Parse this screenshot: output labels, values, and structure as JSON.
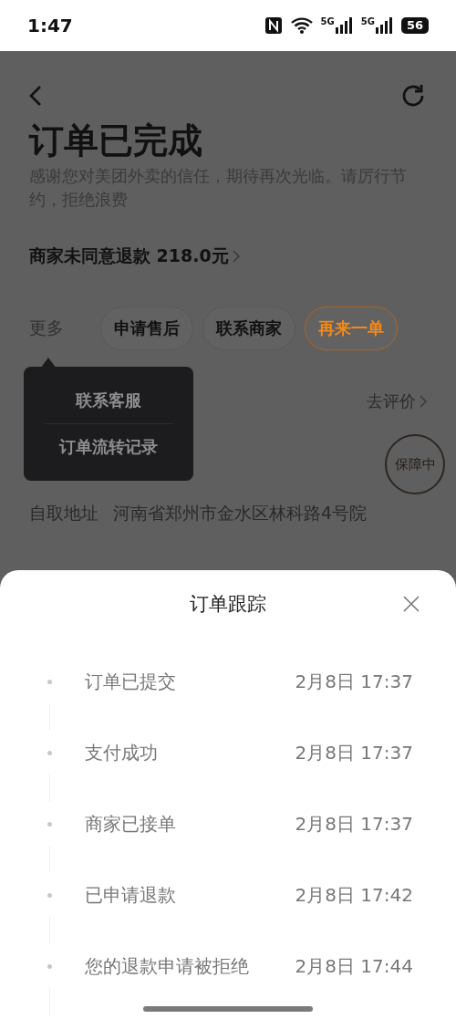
{
  "status_bar": {
    "time": "1:47",
    "networks": [
      "5G",
      "5G"
    ],
    "battery": "56"
  },
  "page": {
    "title": "订单已完成",
    "subtitle": "感谢您对美团外卖的信任，期待再次光临。请厉行节约，拒绝浪费",
    "refund_notice": "商家未同意退款 218.0元",
    "more": "更多",
    "actions": [
      {
        "label": "申请售后",
        "kind": "plain"
      },
      {
        "label": "联系商家",
        "kind": "plain"
      },
      {
        "label": "再来一单",
        "kind": "primary"
      }
    ],
    "rate_link": "去评价",
    "stamp": "保障中",
    "address_label": "自取地址",
    "address": "河南省郑州市金水区林科路4号院"
  },
  "more_menu": {
    "items": [
      "联系客服",
      "订单流转记录"
    ]
  },
  "tracking_sheet": {
    "title": "订单跟踪",
    "events": [
      {
        "status": "订单已提交",
        "time": "2月8日 17:37"
      },
      {
        "status": "支付成功",
        "time": "2月8日 17:37"
      },
      {
        "status": "商家已接单",
        "time": "2月8日 17:37"
      },
      {
        "status": "已申请退款",
        "time": "2月8日 17:42"
      },
      {
        "status": "您的退款申请被拒绝",
        "time": "2月8日 17:44"
      }
    ]
  }
}
